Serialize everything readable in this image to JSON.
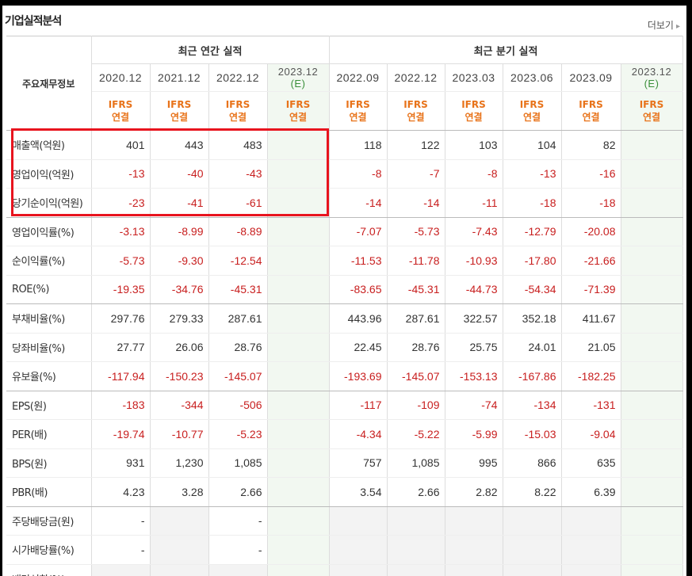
{
  "header": {
    "title": "기업실적분석",
    "more_label": "더보기"
  },
  "groups": {
    "annual": "최근 연간 실적",
    "quarterly": "최근 분기 실적"
  },
  "label_header": "주요재무정보",
  "annual_periods": [
    "2020.12",
    "2021.12",
    "2022.12",
    "2023.12"
  ],
  "quarter_periods": [
    "2022.09",
    "2022.12",
    "2023.03",
    "2023.06",
    "2023.09",
    "2023.12"
  ],
  "estimate_mark": "(E)",
  "ifrs_top": "IFRS",
  "ifrs_bottom": "연결",
  "rows": [
    {
      "label": "매출액(억원)",
      "values": [
        "401",
        "443",
        "483",
        "",
        "118",
        "122",
        "103",
        "104",
        "82",
        ""
      ]
    },
    {
      "label": "영업이익(억원)",
      "values": [
        "-13",
        "-40",
        "-43",
        "",
        "-8",
        "-7",
        "-8",
        "-13",
        "-16",
        ""
      ]
    },
    {
      "label": "당기순이익(억원)",
      "values": [
        "-23",
        "-41",
        "-61",
        "",
        "-14",
        "-14",
        "-11",
        "-18",
        "-18",
        ""
      ]
    },
    {
      "label": "영업이익률(%)",
      "values": [
        "-3.13",
        "-8.99",
        "-8.89",
        "",
        "-7.07",
        "-5.73",
        "-7.43",
        "-12.79",
        "-20.08",
        ""
      ]
    },
    {
      "label": "순이익률(%)",
      "values": [
        "-5.73",
        "-9.30",
        "-12.54",
        "",
        "-11.53",
        "-11.78",
        "-10.93",
        "-17.80",
        "-21.66",
        ""
      ]
    },
    {
      "label": "ROE(%)",
      "values": [
        "-19.35",
        "-34.76",
        "-45.31",
        "",
        "-83.65",
        "-45.31",
        "-44.73",
        "-54.34",
        "-71.39",
        ""
      ]
    },
    {
      "label": "부채비율(%)",
      "values": [
        "297.76",
        "279.33",
        "287.61",
        "",
        "443.96",
        "287.61",
        "322.57",
        "352.18",
        "411.67",
        ""
      ]
    },
    {
      "label": "당좌비율(%)",
      "values": [
        "27.77",
        "26.06",
        "28.76",
        "",
        "22.45",
        "28.76",
        "25.75",
        "24.01",
        "21.05",
        ""
      ]
    },
    {
      "label": "유보율(%)",
      "values": [
        "-117.94",
        "-150.23",
        "-145.07",
        "",
        "-193.69",
        "-145.07",
        "-153.13",
        "-167.86",
        "-182.25",
        ""
      ]
    },
    {
      "label": "EPS(원)",
      "values": [
        "-183",
        "-344",
        "-506",
        "",
        "-117",
        "-109",
        "-74",
        "-134",
        "-131",
        ""
      ]
    },
    {
      "label": "PER(배)",
      "values": [
        "-19.74",
        "-10.77",
        "-5.23",
        "",
        "-4.34",
        "-5.22",
        "-5.99",
        "-15.03",
        "-9.04",
        ""
      ]
    },
    {
      "label": "BPS(원)",
      "values": [
        "931",
        "1,230",
        "1,085",
        "",
        "757",
        "1,085",
        "995",
        "866",
        "635",
        ""
      ]
    },
    {
      "label": "PBR(배)",
      "values": [
        "4.23",
        "3.28",
        "2.66",
        "",
        "3.54",
        "2.66",
        "2.82",
        "8.22",
        "6.39",
        ""
      ]
    },
    {
      "label": "주당배당금(원)",
      "values": [
        "-",
        "",
        "-",
        "",
        "",
        "",
        "",
        "",
        "",
        ""
      ]
    },
    {
      "label": "시가배당률(%)",
      "values": [
        "-",
        "",
        "-",
        "",
        "",
        "",
        "",
        "",
        "",
        ""
      ]
    },
    {
      "label": "배당성향(%)",
      "values": [
        "",
        "",
        "",
        "",
        "",
        "",
        "",
        "",
        "",
        ""
      ]
    }
  ],
  "colors": {
    "negative": "#c81e1e",
    "ifrs": "#e8731a",
    "estimate": "#3a8f3a",
    "highlight_box": "#e8141e"
  }
}
